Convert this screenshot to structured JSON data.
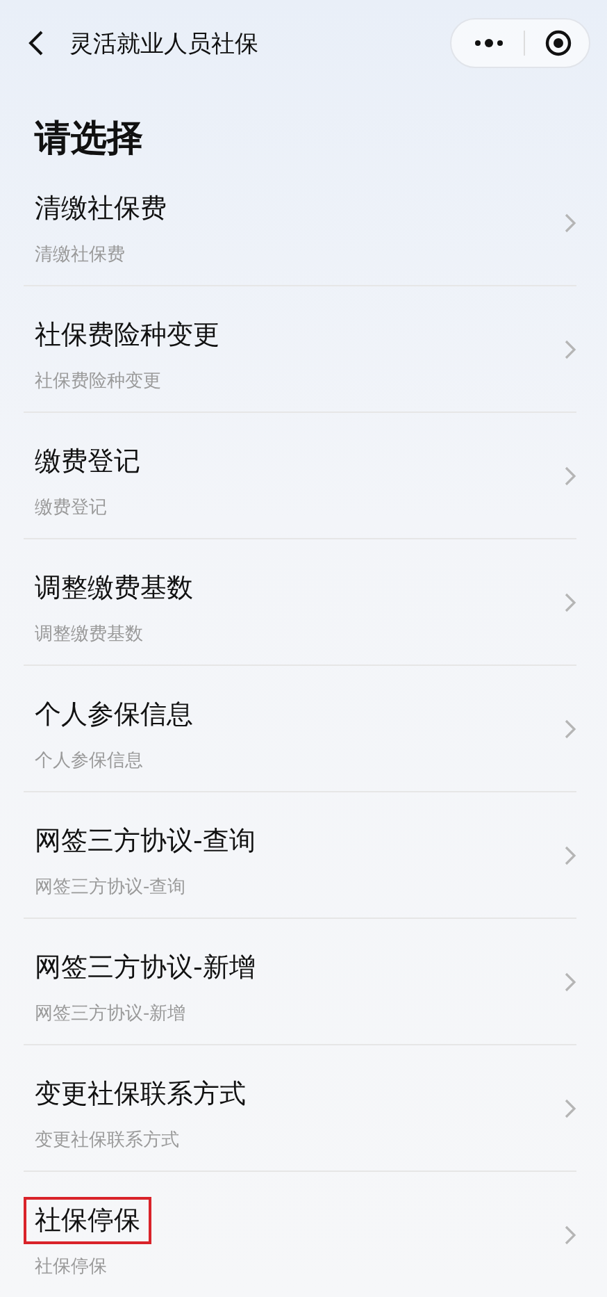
{
  "nav": {
    "title": "灵活就业人员社保"
  },
  "heading": "请选择",
  "items": [
    {
      "title": "清缴社保费",
      "subtitle": "清缴社保费",
      "highlighted": false
    },
    {
      "title": "社保费险种变更",
      "subtitle": "社保费险种变更",
      "highlighted": false
    },
    {
      "title": "缴费登记",
      "subtitle": "缴费登记",
      "highlighted": false
    },
    {
      "title": "调整缴费基数",
      "subtitle": "调整缴费基数",
      "highlighted": false
    },
    {
      "title": "个人参保信息",
      "subtitle": "个人参保信息",
      "highlighted": false
    },
    {
      "title": "网签三方协议-查询",
      "subtitle": "网签三方协议-查询",
      "highlighted": false
    },
    {
      "title": "网签三方协议-新增",
      "subtitle": "网签三方协议-新增",
      "highlighted": false
    },
    {
      "title": "变更社保联系方式",
      "subtitle": "变更社保联系方式",
      "highlighted": false
    },
    {
      "title": "社保停保",
      "subtitle": "社保停保",
      "highlighted": true
    }
  ]
}
